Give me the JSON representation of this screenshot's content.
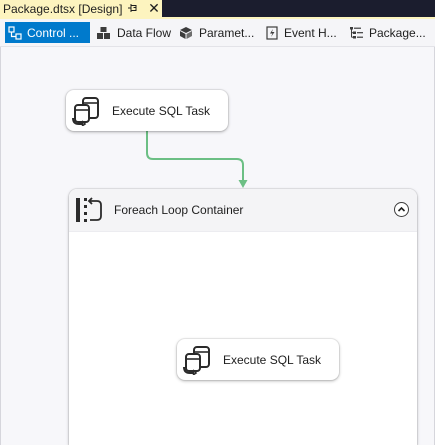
{
  "document_tab": {
    "title": "Package.dtsx [Design]",
    "pin_icon": "pin-icon",
    "close_glyph": "✕"
  },
  "designer_tabs": [
    {
      "label": "Control ...",
      "icon": "control-flow-icon",
      "active": true
    },
    {
      "label": "Data Flow",
      "icon": "data-flow-icon",
      "active": false
    },
    {
      "label": "Paramet...",
      "icon": "parameters-icon",
      "active": false
    },
    {
      "label": "Event H...",
      "icon": "event-handlers-icon",
      "active": false
    },
    {
      "label": "Package...",
      "icon": "package-explorer-icon",
      "active": false
    }
  ],
  "canvas": {
    "top_task": {
      "label": "Execute SQL Task",
      "icon": "execute-sql-task-icon"
    },
    "container": {
      "label": "Foreach Loop Container",
      "icon": "foreach-loop-icon",
      "collapse_icon": "collapse-chevron-icon",
      "inner_task": {
        "label": "Execute SQL Task",
        "icon": "execute-sql-task-icon"
      }
    },
    "connector": {
      "kind": "success-precedence",
      "color": "#6cbf84"
    }
  },
  "colors": {
    "accent": "#007acc",
    "tab_highlight": "#fdf4bf",
    "tabstrip_dark": "#1b1d2e",
    "canvas": "#f7f7fa"
  }
}
